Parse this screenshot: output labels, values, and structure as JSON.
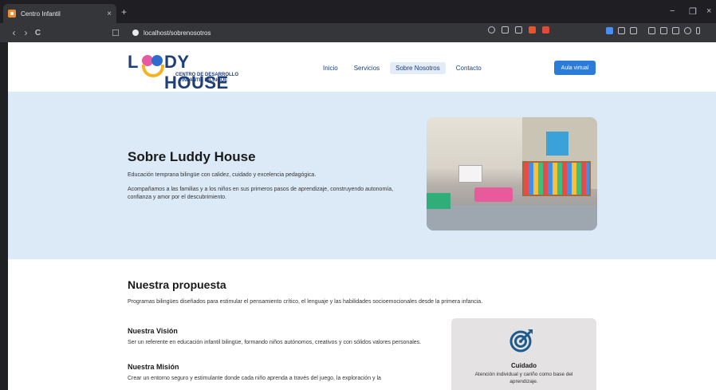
{
  "browser": {
    "tab_title": "Centro Infantil",
    "tab_close": "×",
    "new_tab": "+",
    "url": "localhost/sobrenosotros",
    "back": "‹",
    "forward": "›",
    "reload": "C",
    "minimize": "−",
    "restore": "❐",
    "close": "×"
  },
  "header": {
    "logo_text": "DY HOUSE",
    "logo_l": "L",
    "logo_line1": "CENTRO DE DESARROLLO",
    "logo_line2": "INFANTIL BILINGÜE",
    "nav": [
      "Inicio",
      "Servicios",
      "Sobre Nosotros",
      "Contacto"
    ],
    "cta": "Aula virtual"
  },
  "hero": {
    "title": "Sobre Luddy House",
    "subtitle": "Educación temprana bilingüe con calidez, cuidado y excelencia pedagógica.",
    "description": "Acompañamos a las familias y a los niños en sus primeros pasos de aprendizaje, construyendo autonomía, confianza y amor por el descubrimiento."
  },
  "propuesta": {
    "title": "Nuestra propuesta",
    "description": "Programas bilingües diseñados para estimular el pensamiento crítico, el lenguaje y las habilidades socioemocionales desde la primera infancia.",
    "vision_title": "Nuestra Visión",
    "vision_desc": "Ser un referente en educación infantil bilingüe, formando niños autónomos, creativos y con sólidos valores personales.",
    "mision_title": "Nuestra Misión",
    "mision_desc": "Crear un entorno seguro y estimulante donde cada niño aprenda a través del juego, la exploración y la"
  },
  "card": {
    "icon": "target-icon",
    "title": "Cuidado",
    "description": "Atención individual y cariño como base del aprendizaje."
  },
  "colors": {
    "hero_bg": "#dceaf8",
    "brand_blue": "#1e3f7a",
    "cta_blue": "#2b7bd9"
  }
}
